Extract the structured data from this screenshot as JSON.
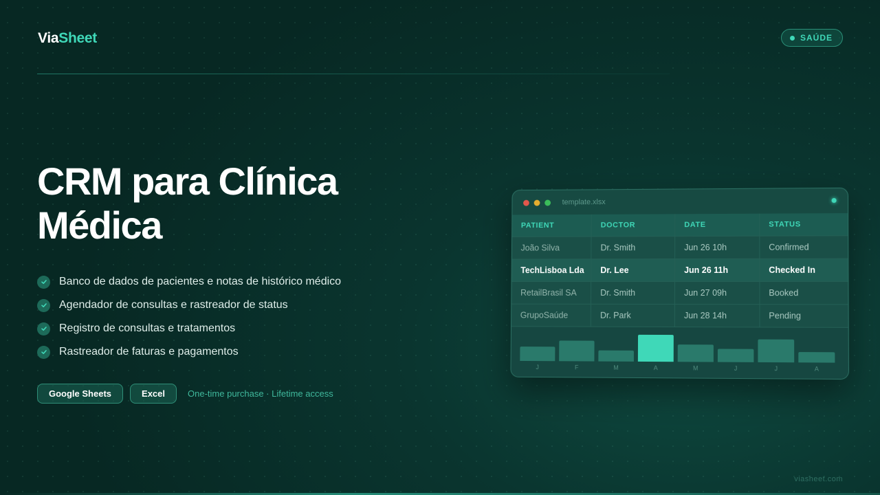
{
  "brand": {
    "part1": "Via",
    "part2": "Sheet"
  },
  "category_badge": "SAÚDE",
  "hero": {
    "line1": "CRM para Clínica",
    "line2": "Médica"
  },
  "features": [
    "Banco de dados de pacientes e notas de histórico médico",
    "Agendador de consultas e rastreador de status",
    "Registro de consultas e tratamentos",
    "Rastreador de faturas e pagamentos"
  ],
  "platforms": [
    "Google Sheets",
    "Excel"
  ],
  "purchase_note": "One-time purchase · Lifetime access",
  "footer_url": "viasheet.com",
  "colors": {
    "accent": "#3fd8b8",
    "background": "#0a352f"
  },
  "preview": {
    "filename": "template.xlsx",
    "columns": [
      "PATIENT",
      "DOCTOR",
      "DATE",
      "STATUS"
    ],
    "rows": [
      [
        "João Silva",
        "Dr. Smith",
        "Jun 26 10h",
        "Confirmed"
      ],
      [
        "TechLisboa Lda",
        "Dr. Lee",
        "Jun 26 11h",
        "Checked In"
      ],
      [
        "RetailBrasil SA",
        "Dr. Smith",
        "Jun 27 09h",
        "Booked"
      ],
      [
        "GrupoSaúde",
        "Dr. Park",
        "Jun 28 14h",
        "Pending"
      ]
    ],
    "highlighted_row": 1
  },
  "chart_data": {
    "type": "bar",
    "categories": [
      "J",
      "F",
      "M",
      "A",
      "M",
      "J",
      "J",
      "A"
    ],
    "values": [
      0.5,
      0.72,
      0.38,
      0.92,
      0.6,
      0.46,
      0.78,
      0.36
    ],
    "highlight_index": 3
  }
}
